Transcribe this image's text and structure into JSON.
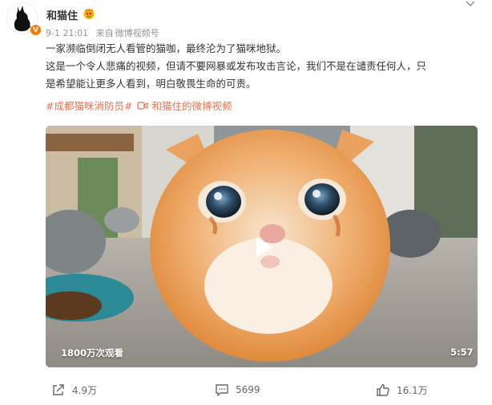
{
  "post": {
    "username": "和猫住",
    "time": "9-1 21:01",
    "source_prefix": "来自",
    "source": "微博视频号",
    "lines": [
      "一家濒临倒闭无人看管的猫咖，最终沦为了猫咪地狱。",
      "这是一个令人悲痛的视频，但请不要网暴或发布攻击言论，我们不是在谴责任何人，只",
      "是希望能让更多人看到，明白敬畏生命的可贵。"
    ],
    "tag": "#成都猫咪消防员#",
    "video_link": "和猫住的微博视频"
  },
  "video": {
    "views": "1800万次观看",
    "duration": "5:57"
  },
  "actions": {
    "share_count": "4.9万",
    "comment_count": "5699",
    "like_count": "16.1万"
  },
  "colors": {
    "link": "#eb7350",
    "badge": "#f57c00",
    "meta": "#939393"
  }
}
